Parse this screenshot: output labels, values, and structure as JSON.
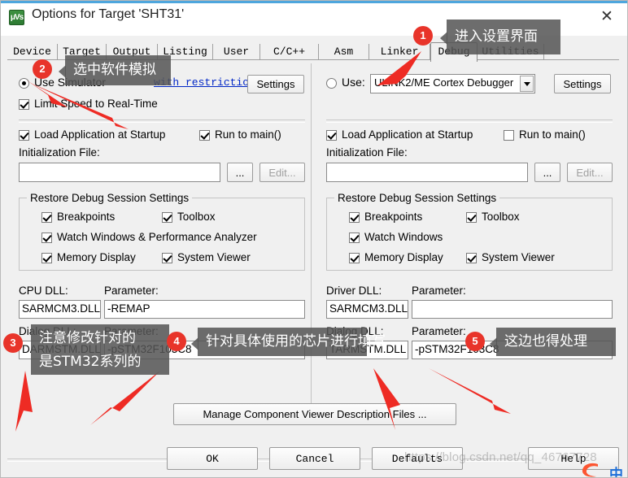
{
  "window": {
    "title": "Options for Target 'SHT31'",
    "app_icon": "keil-uvision-icon",
    "icon_glyph": "μVs",
    "close_label": "✕"
  },
  "tabs": [
    {
      "label": "Device",
      "selected": false
    },
    {
      "label": "Target",
      "selected": false
    },
    {
      "label": "Output",
      "selected": false
    },
    {
      "label": "Listing",
      "selected": false
    },
    {
      "label": "User",
      "selected": false
    },
    {
      "label": "C/C++",
      "selected": false
    },
    {
      "label": "Asm",
      "selected": false
    },
    {
      "label": "Linker",
      "selected": false
    },
    {
      "label": "Debug",
      "selected": true
    },
    {
      "label": "Utilities",
      "selected": false
    }
  ],
  "left_panel": {
    "radio_label": "Use Simulator",
    "radio_checked": true,
    "restrictions_link": "with restrictions",
    "settings_button": "Settings",
    "limit_speed": {
      "label": "Limit Speed to Real-Time",
      "checked": true
    },
    "load_app": {
      "label": "Load Application at Startup",
      "checked": true
    },
    "run_to_main": {
      "label": "Run to main()",
      "checked": true
    },
    "init_file_label": "Initialization File:",
    "init_file_value": "",
    "browse_button": "...",
    "edit_button": "Edit...",
    "restore_group": {
      "title": "Restore Debug Session Settings",
      "items": [
        {
          "label": "Breakpoints",
          "checked": true
        },
        {
          "label": "Toolbox",
          "checked": true
        },
        {
          "label": "Watch Windows & Performance Analyzer",
          "checked": true
        },
        {
          "label": "Memory Display",
          "checked": true
        },
        {
          "label": "System Viewer",
          "checked": true
        }
      ]
    },
    "cpu_dll_label": "CPU DLL:",
    "cpu_dll_value": "SARMCM3.DLL",
    "cpu_param_label": "Parameter:",
    "cpu_param_value": "-REMAP",
    "dialog_dll_label": "Dialog DLL:",
    "dialog_dll_value": "DARMSTM.DLL",
    "dialog_param_label": "Parameter:",
    "dialog_param_value": "-pSTM32F103C8"
  },
  "right_panel": {
    "radio_label": "Use:",
    "radio_checked": false,
    "debugger_selected": "ULINK2/ME Cortex Debugger",
    "settings_button": "Settings",
    "load_app": {
      "label": "Load Application at Startup",
      "checked": true
    },
    "run_to_main": {
      "label": "Run to main()",
      "checked": false
    },
    "init_file_label": "Initialization File:",
    "init_file_value": "",
    "browse_button": "...",
    "edit_button": "Edit...",
    "restore_group": {
      "title": "Restore Debug Session Settings",
      "items": [
        {
          "label": "Breakpoints",
          "checked": true
        },
        {
          "label": "Toolbox",
          "checked": true
        },
        {
          "label": "Watch Windows",
          "checked": true
        },
        {
          "label": "Memory Display",
          "checked": true
        },
        {
          "label": "System Viewer",
          "checked": true
        }
      ]
    },
    "driver_dll_label": "Driver DLL:",
    "driver_dll_value": "SARMCM3.DLL",
    "driver_param_label": "Parameter:",
    "driver_param_value": "",
    "dialog_dll_label": "Dialog DLL:",
    "dialog_dll_value": "TARMSTM.DLL",
    "dialog_param_label": "Parameter:",
    "dialog_param_value": "-pSTM32F103C8"
  },
  "manage_button": "Manage Component Viewer Description Files ...",
  "footer": {
    "ok": "OK",
    "cancel": "Cancel",
    "defaults": "Defaults",
    "help": "Help"
  },
  "annotations": [
    {
      "number": "1",
      "text": "进入设置界面"
    },
    {
      "number": "2",
      "text": "选中软件模拟"
    },
    {
      "number": "3",
      "text": "注意修改针对的\n是STM32系列的"
    },
    {
      "number": "4",
      "text": "针对具体使用的芯片进行填写"
    },
    {
      "number": "5",
      "text": "这边也得处理"
    }
  ],
  "watermark": {
    "text": "https://blog.csdn.net/qq_46767728"
  },
  "colors": {
    "accent": "#4ea6dd",
    "badge": "#e8342a",
    "arrow": "#ee2b24",
    "link": "#0026c6",
    "tooltip_bg": "#555555"
  }
}
